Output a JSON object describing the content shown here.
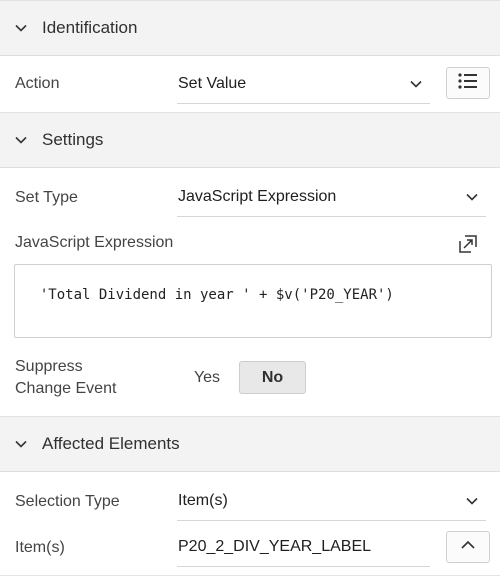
{
  "identification": {
    "title": "Identification",
    "action_label": "Action",
    "action_value": "Set Value"
  },
  "settings": {
    "title": "Settings",
    "set_type_label": "Set Type",
    "set_type_value": "JavaScript Expression",
    "js_expression_label": "JavaScript Expression",
    "js_expression_value": "'Total Dividend in year ' + $v('P20_YEAR')",
    "suppress_label_line1": "Suppress",
    "suppress_label_line2": "Change Event",
    "suppress_yes": "Yes",
    "suppress_no": "No",
    "suppress_selected": "No"
  },
  "affected": {
    "title": "Affected Elements",
    "selection_type_label": "Selection Type",
    "selection_type_value": "Item(s)",
    "items_label": "Item(s)",
    "items_value": "P20_2_DIV_YEAR_LABEL"
  },
  "icons": {
    "section_toggle": "chevron-down-icon",
    "select_caret": "chevron-down-icon",
    "list_button": "list-icon",
    "expand": "expand-editor-icon",
    "collapse_up": "chevron-up-icon"
  }
}
